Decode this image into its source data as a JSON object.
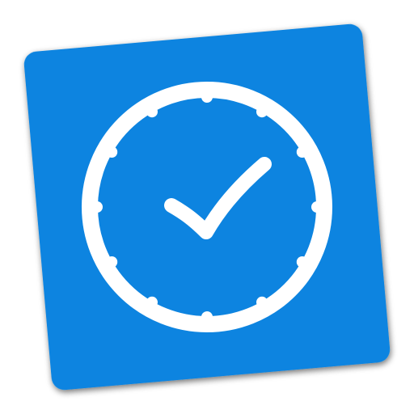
{
  "icon": {
    "name": "clock-check-icon",
    "tile_color": "#0a84e0",
    "glyph_color": "#ffffff",
    "shadow_color": "#1a1a1a"
  }
}
